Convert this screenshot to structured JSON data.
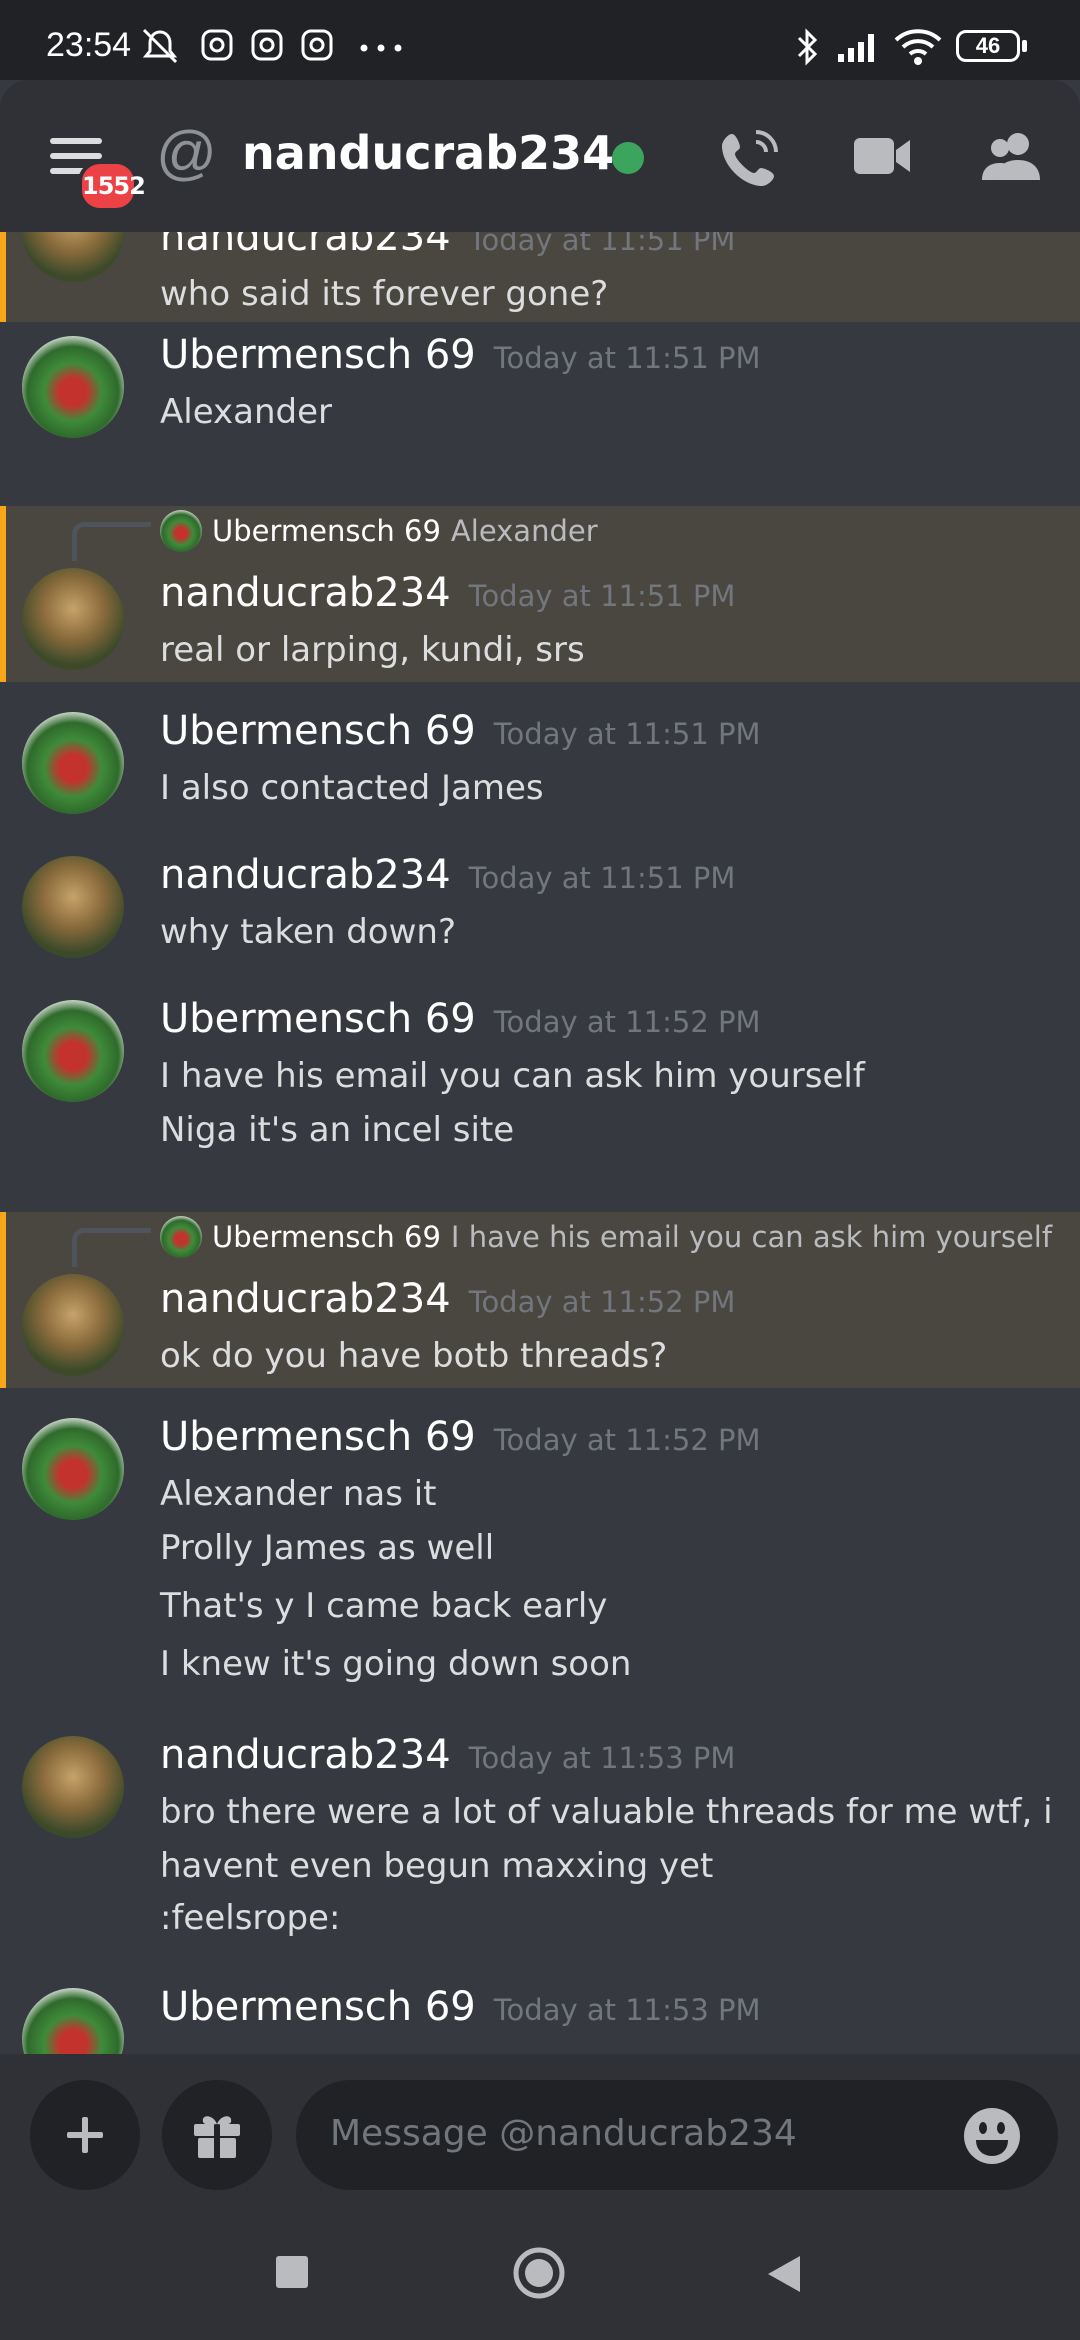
{
  "status_bar": {
    "time": "23:54",
    "battery": "46",
    "left_icons": [
      "mute-bell-icon",
      "instagram-icon",
      "instagram-icon",
      "instagram-icon",
      "more-dots-icon"
    ],
    "right_icons": [
      "bluetooth-icon",
      "signal-icon",
      "wifi-icon",
      "battery-icon"
    ]
  },
  "header": {
    "badge_count": "1552",
    "at_symbol": "@",
    "channel_name": "nanducrab234",
    "status": "online",
    "status_color": "#3ba55d",
    "icons": [
      "phone-call-icon",
      "video-call-icon",
      "members-icon"
    ]
  },
  "messages": [
    {
      "author": "nanducrab234",
      "time": "Today at 11:51 PM",
      "lines": [
        "who said its forever gone?"
      ],
      "highlight": true
    },
    {
      "author": "Ubermensch 69",
      "time": "Today at 11:51 PM",
      "lines": [
        "Alexander"
      ]
    },
    {
      "author": "nanducrab234",
      "time": "Today at 11:51 PM",
      "lines": [
        "real or larping, kundi, srs"
      ],
      "highlight": true,
      "reply": {
        "author": "Ubermensch 69",
        "text": "Alexander"
      }
    },
    {
      "author": "Ubermensch 69",
      "time": "Today at 11:51 PM",
      "lines": [
        "I also contacted James"
      ]
    },
    {
      "author": "nanducrab234",
      "time": "Today at 11:51 PM",
      "lines": [
        "why taken down?"
      ]
    },
    {
      "author": "Ubermensch 69",
      "time": "Today at 11:52 PM",
      "lines": [
        "I have his email you can ask him yourself",
        "Niga it's an incel site"
      ]
    },
    {
      "author": "nanducrab234",
      "time": "Today at 11:52 PM",
      "lines": [
        "ok do you have botb threads?"
      ],
      "highlight": true,
      "reply": {
        "author": "Ubermensch 69",
        "text": "I have his email you can ask him yourself"
      }
    },
    {
      "author": "Ubermensch 69",
      "time": "Today at 11:52 PM",
      "lines": [
        "Alexander nas it",
        "Prolly James as well",
        "That's y I came back early",
        "I knew it's going down soon"
      ]
    },
    {
      "author": "nanducrab234",
      "time": "Today at 11:53 PM",
      "lines": [
        "bro there were a lot of valuable threads for me wtf, i",
        "havent even begun maxxing yet",
        ":feelsrope:"
      ]
    },
    {
      "author": "Ubermensch 69",
      "time": "Today at 11:53 PM",
      "lines": []
    }
  ],
  "composer": {
    "placeholder": "Message @nanducrab234",
    "icons": [
      "plus-icon",
      "gift-icon",
      "emoji-icon"
    ]
  },
  "nav_bar": {
    "icons": [
      "recents-square-icon",
      "home-circle-icon",
      "back-triangle-icon"
    ]
  },
  "colors": {
    "background": "#36393f",
    "header": "#2f3136",
    "highlight_bg": "#4a4640",
    "highlight_bar": "#faa61a",
    "badge": "#ed4245"
  }
}
